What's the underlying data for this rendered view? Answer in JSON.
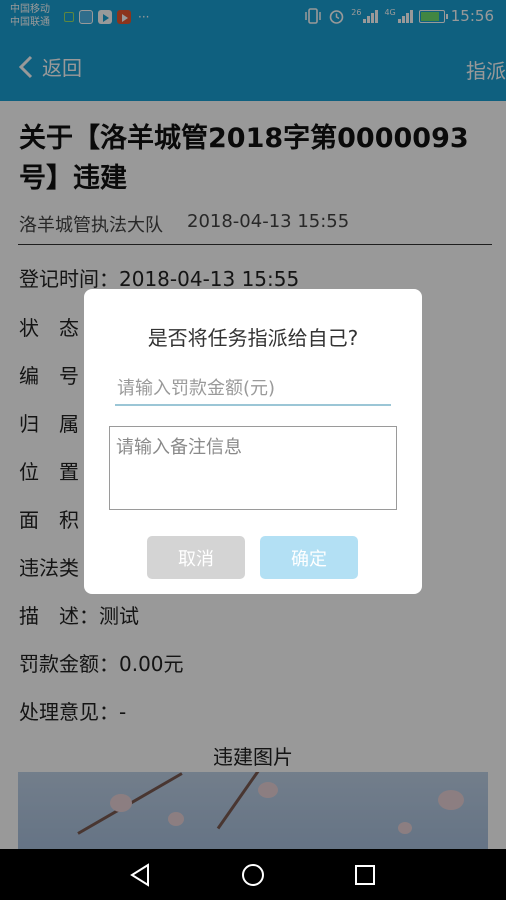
{
  "status_bar": {
    "carrier_1": "中国移动",
    "carrier_2": "中国联通",
    "more_indicator": "···",
    "signal_1_label": "26",
    "signal_2_label": "4G",
    "time": "15:56",
    "battery_level": 0.85,
    "app_icons": [
      "app-icon-green",
      "app-icon-blue",
      "app-icon-play",
      "app-icon-red-play"
    ]
  },
  "app_bar": {
    "back_label": "返回",
    "action_label": "指派"
  },
  "detail": {
    "title": "关于【洛羊城管2018字第0000093号】违建",
    "department": "洛羊城管执法大队",
    "datetime": "2018-04-13 15:55",
    "fields": {
      "register_time": "登记时间：2018-04-13 15:55",
      "status": "状　态",
      "number": "编　号",
      "belong": "归　属",
      "location": "位　置",
      "area": "面　积",
      "violation_type": "违法类",
      "description": "描　述：测试",
      "fine_amount": "罚款金额：0.00元",
      "opinion": "处理意见：-"
    },
    "pictures_heading": "违建图片"
  },
  "dialog": {
    "title": "是否将任务指派给自己?",
    "amount_placeholder": "请输入罚款金额(元)",
    "remark_placeholder": "请输入备注信息",
    "cancel_label": "取消",
    "confirm_label": "确定"
  },
  "colors": {
    "primary": "#1aa1d4",
    "cancel_button": "#d4d4d4",
    "confirm_button": "#b3e0f4",
    "input_underline": "#9bc6d6"
  }
}
